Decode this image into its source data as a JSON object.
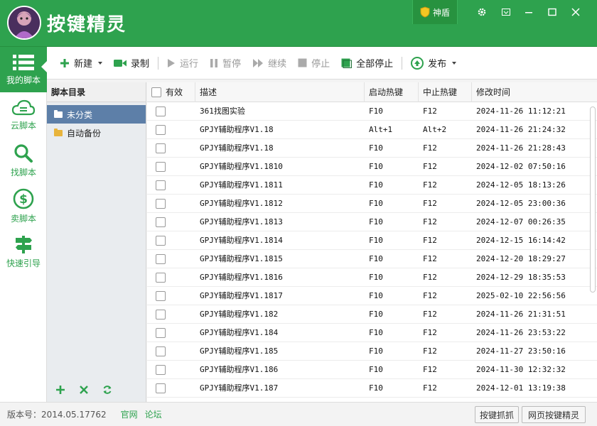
{
  "app": {
    "title": "按键精灵",
    "shendun": "神盾"
  },
  "sidebar": {
    "items": [
      {
        "label": "我的脚本",
        "icon": "list-icon"
      },
      {
        "label": "云脚本",
        "icon": "cloud-icon"
      },
      {
        "label": "找脚本",
        "icon": "search-icon"
      },
      {
        "label": "卖脚本",
        "icon": "dollar-icon"
      },
      {
        "label": "快速引导",
        "icon": "signpost-icon"
      }
    ]
  },
  "toolbar": {
    "new": "新建",
    "record": "录制",
    "run": "运行",
    "pause": "暂停",
    "resume": "继续",
    "stop": "停止",
    "stop_all": "全部停止",
    "publish": "发布"
  },
  "tree": {
    "header": "脚本目录",
    "items": [
      {
        "label": "未分类"
      },
      {
        "label": "自动备份"
      }
    ]
  },
  "table": {
    "headers": {
      "enabled": "有效",
      "desc": "描述",
      "start": "启动热键",
      "stop": "中止热键",
      "time": "修改时间"
    },
    "rows": [
      {
        "desc": "361找图实验",
        "start": "F10",
        "stop": "F12",
        "time": "2024-11-26 11:12:21"
      },
      {
        "desc": "GPJY辅助程序V1.18",
        "start": "Alt+1",
        "stop": "Alt+2",
        "time": "2024-11-26 21:24:32"
      },
      {
        "desc": "GPJY辅助程序V1.18",
        "start": "F10",
        "stop": "F12",
        "time": "2024-11-26 21:28:43"
      },
      {
        "desc": "GPJY辅助程序V1.1810",
        "start": "F10",
        "stop": "F12",
        "time": "2024-12-02 07:50:16"
      },
      {
        "desc": "GPJY辅助程序V1.1811",
        "start": "F10",
        "stop": "F12",
        "time": "2024-12-05 18:13:26"
      },
      {
        "desc": "GPJY辅助程序V1.1812",
        "start": "F10",
        "stop": "F12",
        "time": "2024-12-05 23:00:36"
      },
      {
        "desc": "GPJY辅助程序V1.1813",
        "start": "F10",
        "stop": "F12",
        "time": "2024-12-07 00:26:35"
      },
      {
        "desc": "GPJY辅助程序V1.1814",
        "start": "F10",
        "stop": "F12",
        "time": "2024-12-15 16:14:42"
      },
      {
        "desc": "GPJY辅助程序V1.1815",
        "start": "F10",
        "stop": "F12",
        "time": "2024-12-20 18:29:27"
      },
      {
        "desc": "GPJY辅助程序V1.1816",
        "start": "F10",
        "stop": "F12",
        "time": "2024-12-29 18:35:53"
      },
      {
        "desc": "GPJY辅助程序V1.1817",
        "start": "F10",
        "stop": "F12",
        "time": "2025-02-10 22:56:56"
      },
      {
        "desc": "GPJY辅助程序V1.182",
        "start": "F10",
        "stop": "F12",
        "time": "2024-11-26 21:31:51"
      },
      {
        "desc": "GPJY辅助程序V1.184",
        "start": "F10",
        "stop": "F12",
        "time": "2024-11-26 23:53:22"
      },
      {
        "desc": "GPJY辅助程序V1.185",
        "start": "F10",
        "stop": "F12",
        "time": "2024-11-27 23:50:16"
      },
      {
        "desc": "GPJY辅助程序V1.186",
        "start": "F10",
        "stop": "F12",
        "time": "2024-11-30 12:32:32"
      },
      {
        "desc": "GPJY辅助程序V1.187",
        "start": "F10",
        "stop": "F12",
        "time": "2024-12-01 13:19:38"
      }
    ]
  },
  "status": {
    "version_label": "版本号：",
    "version": "2014.05.17762",
    "link_official": "官网",
    "link_forum": "论坛",
    "btn_capture": "按键抓抓",
    "btn_web": "网页按键精灵"
  },
  "colors": {
    "brand": "#2ea24e",
    "selected": "#5d7fa8"
  }
}
